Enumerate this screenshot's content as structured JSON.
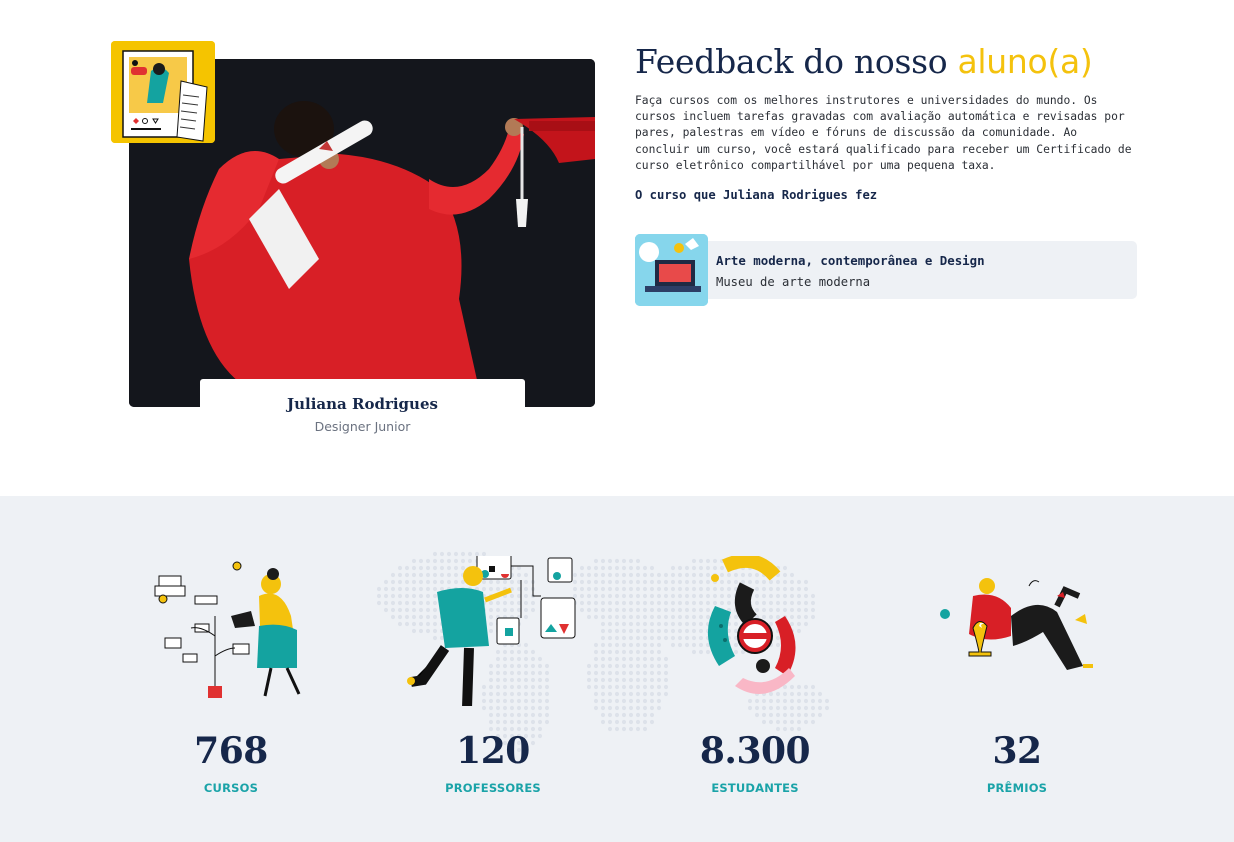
{
  "testimonial": {
    "heading_main": "Feedback do nosso ",
    "heading_accent": "aluno(a)",
    "description": "Faça cursos com os melhores instrutores e universidades do mundo. Os cursos incluem tarefas gravadas com avaliação automática e revisadas por pares, palestras em vídeo e fóruns de discussão da comunidade. Ao concluir um curso, você estará qualificado para receber um Certificado de curso eletrônico compartilhável por uma pequena taxa.",
    "course_heading": "O curso que Juliana Rodrigues fez",
    "student_name": "Juliana Rodrigues",
    "student_role": "Designer Junior",
    "course": {
      "name": "Arte moderna, contemporânea e Design",
      "organization": "Museu de arte moderna"
    }
  },
  "stats": [
    {
      "value": "768",
      "label": "CURSOS",
      "icon": "plant-watering-illustration"
    },
    {
      "value": "120",
      "label": "PROFESSORES",
      "icon": "teacher-diagram-illustration"
    },
    {
      "value": "8.300",
      "label": "ESTUDANTES",
      "icon": "students-circle-illustration"
    },
    {
      "value": "32",
      "label": "PRÊMIOS",
      "icon": "trophy-illustration"
    }
  ],
  "colors": {
    "navy": "#16274a",
    "accent_yellow": "#f4c20d",
    "teal": "#1aa3a8",
    "stats_background": "#eef1f5"
  }
}
